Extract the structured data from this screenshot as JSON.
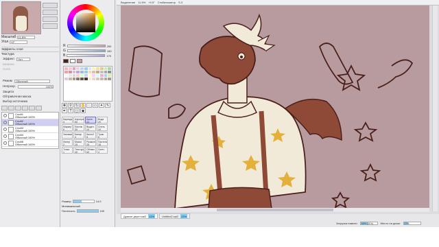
{
  "toolbar": {
    "selection": "Выделение",
    "zoom": "11.8%",
    "angle": "+0.5°",
    "stabilizer_label": "Стабилизатор",
    "stabilizer_value": "S-3"
  },
  "navigator": {
    "zoom_label": "Масштаб",
    "zoom_value": "11.8%",
    "rotate_label": "Угол",
    "rotate_value": "+0°"
  },
  "layer_props": {
    "section_effects": "Эффекты слоя",
    "section_texture": "Текстура",
    "effect_label": "Эффект",
    "effect_value": "Нет",
    "width_label": "Ширина",
    "strength_label": "Сила",
    "mode_label": "Режим",
    "mode_value": "Обычный",
    "opacity_label": "Непрозр.",
    "opacity_value": "100%",
    "protect_label": "Защита",
    "clip_label": "Обтравочная маска",
    "select_label": "Выбор источника"
  },
  "layers": [
    {
      "name": "Слой1",
      "mode": "Обычный",
      "opacity": "100%",
      "selected": false
    },
    {
      "name": "Слой2",
      "mode": "Обычный",
      "opacity": "100%",
      "selected": true
    },
    {
      "name": "Слой3",
      "mode": "Обычный",
      "opacity": "100%",
      "selected": false
    },
    {
      "name": "Слой4",
      "mode": "Обычный",
      "opacity": "100%",
      "selected": false
    },
    {
      "name": "Слой5",
      "mode": "Обычный",
      "opacity": "100%",
      "selected": false
    }
  ],
  "color_sliders": [
    {
      "label": "R",
      "value": "200",
      "gradient": "#c8a6a8"
    },
    {
      "label": "G",
      "value": "150",
      "gradient": "#8aa8c8"
    },
    {
      "label": "B",
      "value": "170",
      "gradient": "#a8a8d8"
    }
  ],
  "swatch_colors": [
    "#f4b6c8",
    "#f7c8d8",
    "#e8a0b8",
    "#f0d0e0",
    "#b8d8f0",
    "#a0c8f0",
    "#d0e8f8",
    "#f8f0c0",
    "#f0e0a0",
    "#e8c890",
    "#c8e8c0",
    "#a8d8a8",
    "#f0a0a0",
    "#e09090",
    "#d0c0e8",
    "#b8a8e0",
    "#a0b8e8",
    "#98d0e0",
    "#f8d8b8",
    "#e0c0a0",
    "#c8a888",
    "#c0c0c0",
    "#a8a8a8",
    "#909090",
    "#f8f8f8",
    "#e8e8e8",
    "#d8d8d8",
    "#ffcccc",
    "#ccffcc",
    "#ccccff",
    "#ffffcc",
    "#ffccff",
    "#ccffff",
    "#f0b0d0",
    "#b0d0f0",
    "#d0f0b0",
    "#e8c8d8",
    "#c8b8a8",
    "#a89888",
    "#887868",
    "#685848",
    "#483828",
    "#f8e8d8",
    "#e8d8c8",
    "#d8c8b8",
    "#c8b8a8",
    "#b8a898",
    "#a89888"
  ],
  "brushes": [
    {
      "name": "Карандаш",
      "size": "3"
    },
    {
      "name": "Аэрограф",
      "size": "50"
    },
    {
      "name": "Кисть",
      "size": "12"
    },
    {
      "name": "Вода",
      "size": "20"
    },
    {
      "name": "Маркер",
      "size": "5"
    },
    {
      "name": "Ластик",
      "size": "30"
    },
    {
      "name": "Выдел.",
      "size": "10"
    },
    {
      "name": "Снять",
      "size": "10"
    },
    {
      "name": "Заливка",
      "size": ""
    },
    {
      "name": "Бинар",
      "size": "4"
    },
    {
      "name": "Кисть2",
      "size": "8"
    },
    {
      "name": "Тушь",
      "size": "6"
    },
    {
      "name": "Линер",
      "size": "2"
    },
    {
      "name": "Мазок",
      "size": "15"
    },
    {
      "name": "Размыть",
      "size": "25"
    },
    {
      "name": "Пастель",
      "size": "18"
    },
    {
      "name": "Точка",
      "size": "1"
    },
    {
      "name": "Текстура",
      "size": "40"
    },
    {
      "name": "Облако",
      "size": "60"
    },
    {
      "name": "Скетч",
      "size": "4"
    }
  ],
  "brush_props": {
    "size_label": "Размер",
    "size_value": "14.0",
    "min_label": "Минимальный",
    "density_label": "Плотность",
    "density_value": "100"
  },
  "tabs": [
    {
      "name": "Дракон дерет.sai2",
      "percent": "11%"
    },
    {
      "name": "Untitled2.sai2",
      "percent": "22%"
    }
  ],
  "status": {
    "memory_label": "Загрузка памяти",
    "memory_value": "44% (51%)",
    "disk_label": "Место на диске",
    "disk_value": "27%"
  },
  "colors": {
    "canvas_bg": "#b89b9e",
    "accent": "#7fd0f4",
    "line": "#4a1f1a",
    "fur": "#8e4a36",
    "cream": "#f2ead8",
    "star": "#e3b13a"
  }
}
